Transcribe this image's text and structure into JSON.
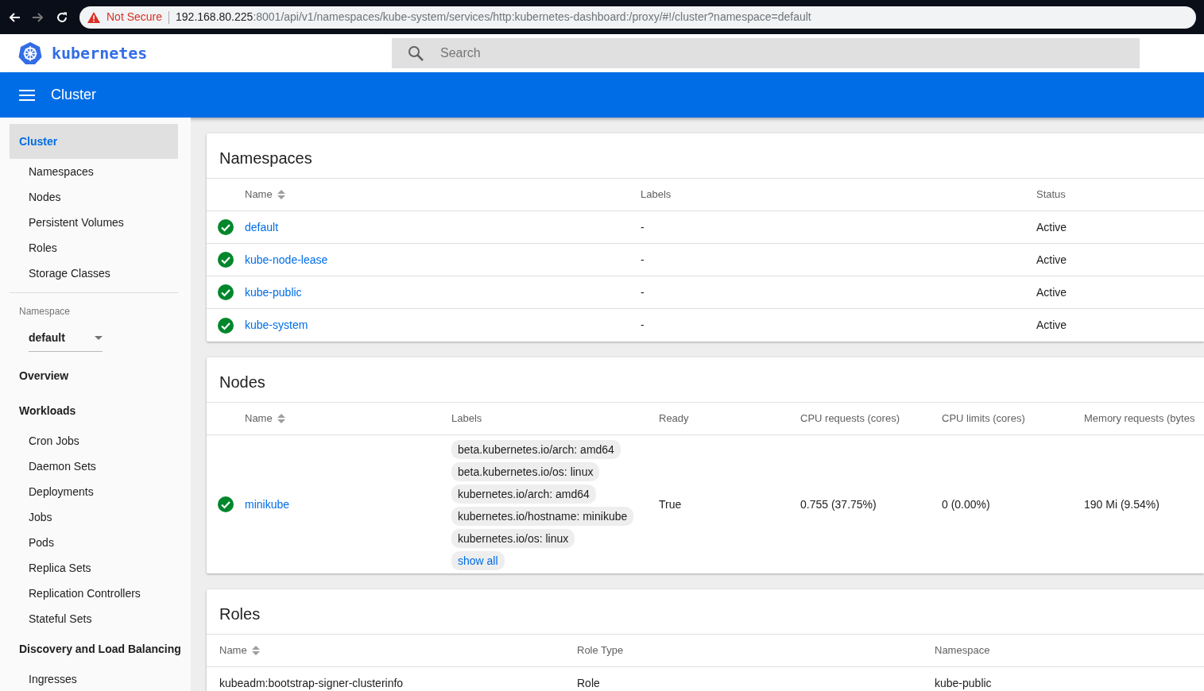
{
  "browser": {
    "back_disabled": false,
    "forward_disabled": true,
    "security_warning": "Not Secure",
    "url_host": "192.168.80.225",
    "url_path": ":8001/api/v1/namespaces/kube-system/services/http:kubernetes-dashboard:/proxy/#!/cluster?namespace=default"
  },
  "header": {
    "logo_text": "kubernetes",
    "search": {
      "placeholder": "Search"
    }
  },
  "toolbar": {
    "title": "Cluster"
  },
  "sidebar": [
    {
      "kind": "nav",
      "title": "Cluster",
      "selected": true,
      "children": [
        {
          "label": "Namespaces"
        },
        {
          "label": "Nodes"
        },
        {
          "label": "Persistent Volumes"
        },
        {
          "label": "Roles"
        },
        {
          "label": "Storage Classes"
        }
      ]
    },
    {
      "kind": "namespace",
      "label": "Namespace",
      "value": "default"
    },
    {
      "kind": "nav",
      "title": "Overview",
      "selected": false
    },
    {
      "kind": "nav",
      "title": "Workloads",
      "selected": false,
      "children": [
        {
          "label": "Cron Jobs"
        },
        {
          "label": "Daemon Sets"
        },
        {
          "label": "Deployments"
        },
        {
          "label": "Jobs"
        },
        {
          "label": "Pods"
        },
        {
          "label": "Replica Sets"
        },
        {
          "label": "Replication Controllers"
        },
        {
          "label": "Stateful Sets"
        }
      ]
    },
    {
      "kind": "nav",
      "title": "Discovery and Load Balancing",
      "selected": false,
      "children": [
        {
          "label": "Ingresses"
        }
      ]
    }
  ],
  "cards": [
    {
      "kind": "namespaces",
      "title": "Namespaces",
      "columns": [
        {
          "label": "Name",
          "sortable": true
        },
        {
          "label": "Labels",
          "sortable": false
        },
        {
          "label": "Status",
          "sortable": false
        }
      ],
      "rows": [
        {
          "ready": true,
          "cells": [
            "default",
            "-",
            "Active"
          ]
        },
        {
          "ready": true,
          "cells": [
            "kube-node-lease",
            "-",
            "Active"
          ]
        },
        {
          "ready": true,
          "cells": [
            "kube-public",
            "-",
            "Active"
          ]
        },
        {
          "ready": true,
          "cells": [
            "kube-system",
            "-",
            "Active"
          ]
        }
      ]
    },
    {
      "kind": "nodes",
      "title": "Nodes",
      "columns": [
        {
          "label": "Name",
          "sortable": true
        },
        {
          "label": "Labels",
          "sortable": false
        },
        {
          "label": "Ready",
          "sortable": false
        },
        {
          "label": "CPU requests (cores)",
          "sortable": false
        },
        {
          "label": "CPU limits (cores)",
          "sortable": false
        },
        {
          "label": "Memory requests (bytes"
        }
      ],
      "rows": [
        {
          "ready": true,
          "cells": [
            "minikube",
            {
              "labels": [
                "beta.kubernetes.io/arch: amd64",
                "beta.kubernetes.io/os: linux",
                "kubernetes.io/arch: amd64",
                "kubernetes.io/hostname: minikube",
                "kubernetes.io/os: linux"
              ],
              "show_all": "show all"
            },
            "True",
            "0.755 (37.75%)",
            "0 (0.00%)",
            "190 Mi (9.54%)"
          ]
        }
      ]
    },
    {
      "kind": "roles",
      "title": "Roles",
      "columns": [
        {
          "label": "Name",
          "sortable": true
        },
        {
          "label": "Role Type",
          "sortable": false
        },
        {
          "label": "Namespace",
          "sortable": false
        }
      ],
      "rows": [
        {
          "cells": [
            "kubeadm:bootstrap-signer-clusterinfo",
            "Role",
            "kube-public"
          ]
        }
      ]
    }
  ]
}
